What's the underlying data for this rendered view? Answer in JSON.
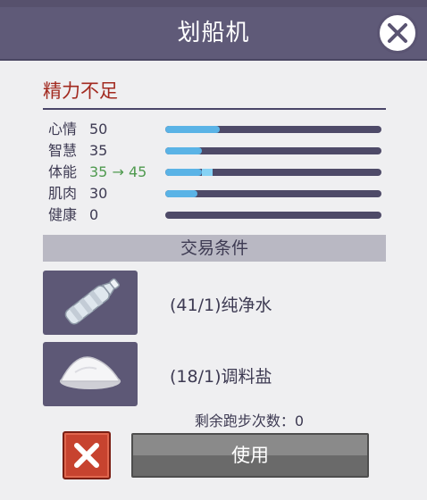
{
  "dialog": {
    "title": "划船机",
    "warning": "精力不足"
  },
  "stats": [
    {
      "name": "心情",
      "value": "50",
      "level": 0.25,
      "gain": 0
    },
    {
      "name": "智慧",
      "value": "35",
      "level": 0.17,
      "gain": 0
    },
    {
      "name": "体能",
      "value": "35 → 45",
      "level": 0.17,
      "gain": 0.05,
      "value_color": "#4f9a4f"
    },
    {
      "name": "肌肉",
      "value": "30",
      "level": 0.15,
      "gain": 0
    },
    {
      "name": "健康",
      "value": "0",
      "level": 0,
      "gain": 0
    }
  ],
  "trade": {
    "header": "交易条件",
    "items": [
      {
        "label": "(41/1)纯净水",
        "icon": "water-bottle-icon"
      },
      {
        "label": "(18/1)调料盐",
        "icon": "salt-pile-icon"
      }
    ]
  },
  "footer": {
    "remaining_runs": "剩余跑步次数：0",
    "use_label": "使用"
  },
  "colors": {
    "header_bg": "#5f5a78",
    "warning": "#a22a20",
    "bar_fill": "#5ab3e6",
    "bar_track": "#4e4a68",
    "cancel": "#c7432f"
  }
}
